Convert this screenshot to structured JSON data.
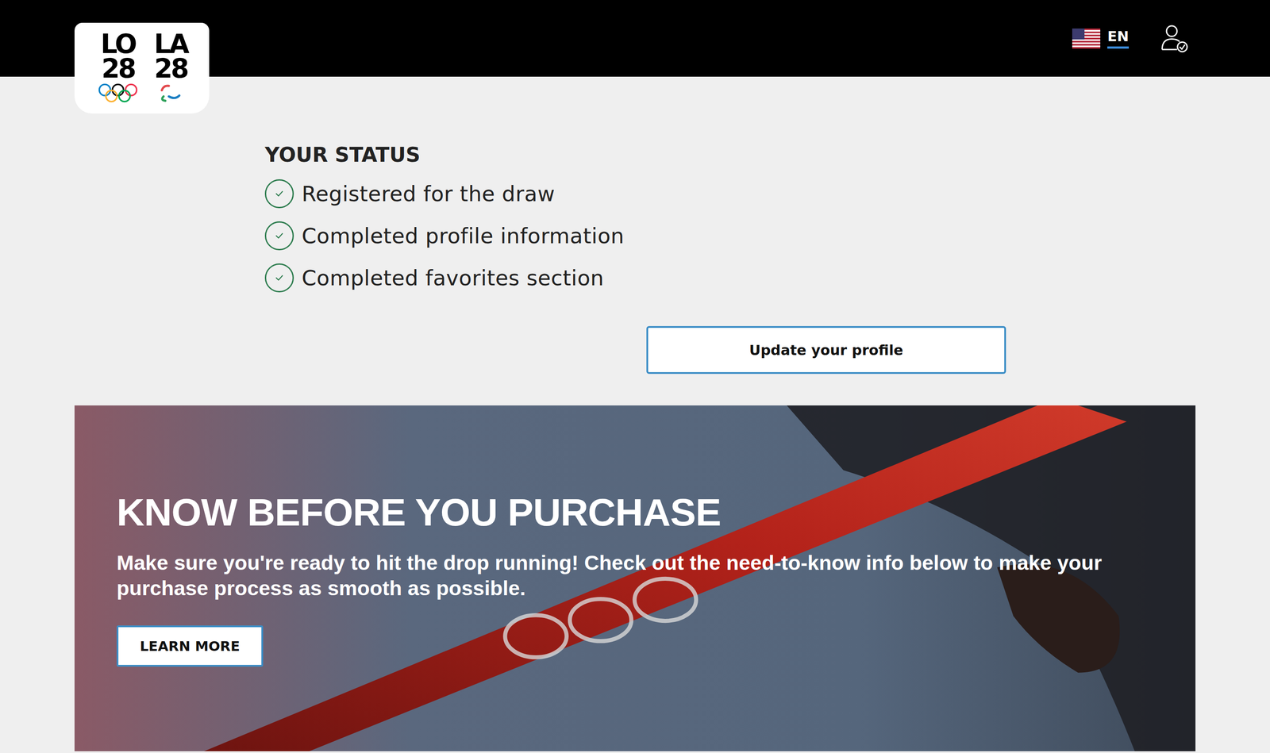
{
  "header": {
    "logos": [
      {
        "top": "LO",
        "bottom": "28"
      },
      {
        "top": "LA",
        "bottom": "28"
      }
    ],
    "language": {
      "label": "EN",
      "selected": true
    }
  },
  "status": {
    "title": "YOUR STATUS",
    "items": [
      {
        "label": "Registered for the draw",
        "checked": true
      },
      {
        "label": "Completed profile information",
        "checked": true
      },
      {
        "label": "Completed favorites section",
        "checked": true
      }
    ]
  },
  "update_button": "Update your profile",
  "banner": {
    "title": "KNOW BEFORE YOU PURCHASE",
    "text": "Make sure you're ready to hit the drop running! Check out the need-to-know info below to make your purchase process as smooth as possible.",
    "button": "LEARN MORE"
  }
}
